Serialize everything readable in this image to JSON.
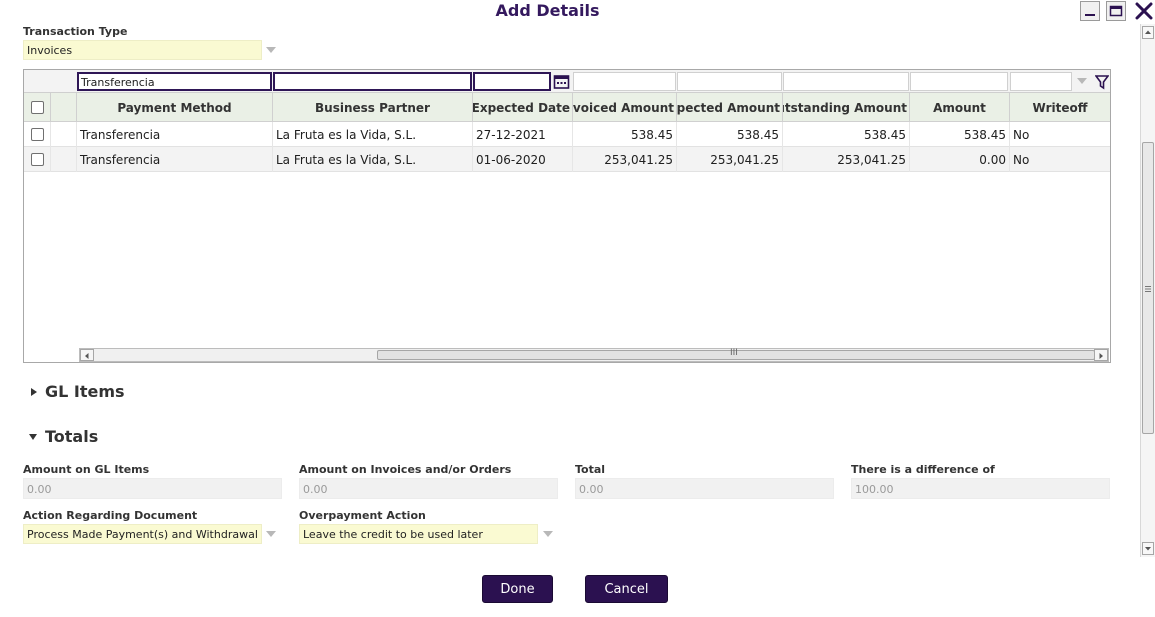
{
  "window": {
    "title": "Add Details"
  },
  "transaction_type": {
    "label": "Transaction Type",
    "value": "Invoices"
  },
  "grid": {
    "filters": {
      "payment_method": "Transferencia",
      "business_partner": "",
      "expected_date": "",
      "invoiced_amount": "",
      "expected_amount": "",
      "outstanding_amount": "",
      "amount": "",
      "writeoff": ""
    },
    "columns": [
      "Payment Method",
      "Business Partner",
      "Expected Date",
      "Invoiced Amount",
      "Expected Amount",
      "Outstanding Amount",
      "Amount",
      "Writeoff"
    ],
    "rows": [
      {
        "payment_method": "Transferencia",
        "business_partner": "La Fruta es la Vida, S.L.",
        "expected_date": "27-12-2021",
        "invoiced_amount": "538.45",
        "expected_amount": "538.45",
        "outstanding_amount": "538.45",
        "amount": "538.45",
        "writeoff": "No"
      },
      {
        "payment_method": "Transferencia",
        "business_partner": "La Fruta es la Vida, S.L.",
        "expected_date": "01-06-2020",
        "invoiced_amount": "253,041.25",
        "expected_amount": "253,041.25",
        "outstanding_amount": "253,041.25",
        "amount": "0.00",
        "writeoff": "No"
      }
    ],
    "scroll_thumb_glyph": "III"
  },
  "sections": {
    "gl_items": "GL Items",
    "totals": "Totals"
  },
  "totals": {
    "amount_gl_items": {
      "label": "Amount on GL Items",
      "value": "0.00"
    },
    "amount_invoices": {
      "label": "Amount on Invoices and/or Orders",
      "value": "0.00"
    },
    "total": {
      "label": "Total",
      "value": "0.00"
    },
    "difference": {
      "label": "There is a difference of",
      "value": "100.00"
    },
    "action_document": {
      "label": "Action Regarding Document",
      "value": "Process Made Payment(s) and Withdrawal"
    },
    "overpayment": {
      "label": "Overpayment Action",
      "value": "Leave the credit to be used later"
    }
  },
  "buttons": {
    "done": "Done",
    "cancel": "Cancel"
  },
  "colors": {
    "title": "#34195e",
    "button": "#2b1150",
    "required_field": "#fafad2",
    "header": "#eaf0e6"
  }
}
